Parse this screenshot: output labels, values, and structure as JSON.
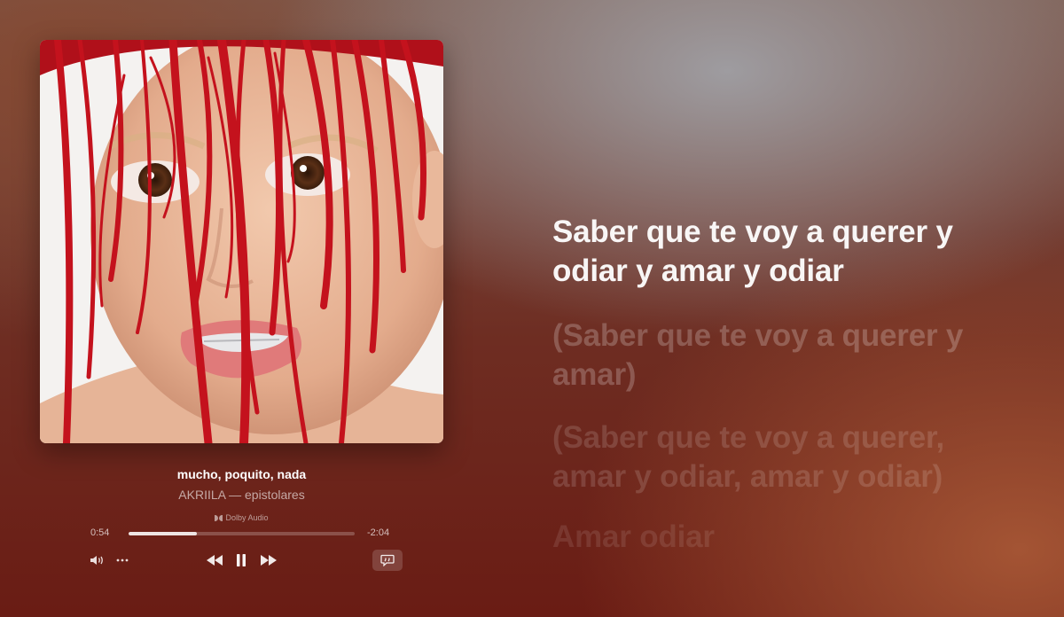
{
  "now_playing": {
    "title": "mucho, poquito, nada",
    "subtitle": "AKRIILA — epistolares",
    "audio_badge": "Dolby Audio"
  },
  "playback": {
    "elapsed": "0:54",
    "remaining": "-2:04",
    "progress_fraction": 0.3
  },
  "controls": {
    "volume_icon": "volume-icon",
    "more_icon": "ellipsis-icon",
    "rewind_icon": "rewind-icon",
    "pause_icon": "pause-icon",
    "forward_icon": "fast-forward-icon",
    "lyrics_icon": "lyrics-icon"
  },
  "lyrics": [
    "Saber que te voy a querer y odiar y amar y odiar",
    "(Saber que te voy a querer y amar)",
    "(Saber que te voy a querer, amar y odiar, amar y odiar)",
    "Amar odiar"
  ],
  "colors": {
    "accent_text": "#ffffff",
    "background_top": "#7c5a4e",
    "background_bottom": "#6a1c14"
  }
}
